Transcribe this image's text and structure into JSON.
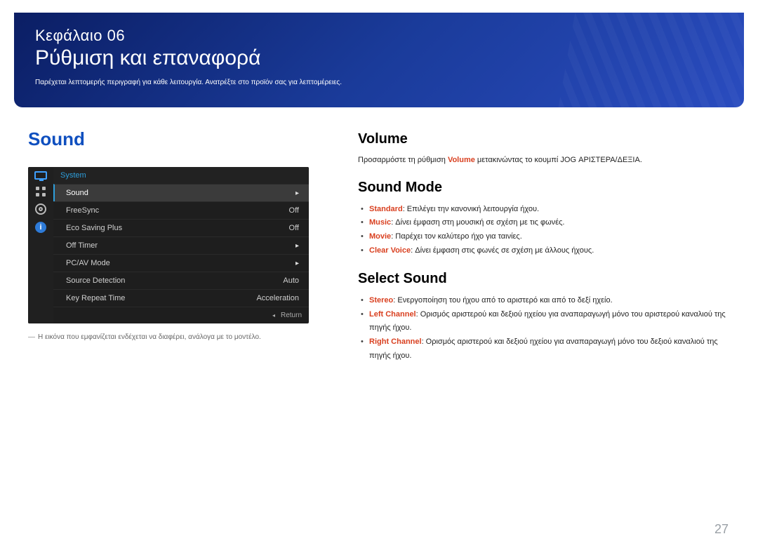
{
  "banner": {
    "chapter": "Κεφάλαιο 06",
    "title": "Ρύθμιση και επαναφορά",
    "subtitle": "Παρέχεται λεπτομερής περιγραφή για κάθε λειτουργία. Ανατρέξτε στο προϊόν σας για λεπτομέρειες."
  },
  "left": {
    "heading": "Sound",
    "footnote": "Η εικόνα που εμφανίζεται ενδέχεται να διαφέρει, ανάλογα με το μοντέλο."
  },
  "osd": {
    "header": "System",
    "rows": [
      {
        "label": "Sound",
        "value": "",
        "selected": true,
        "arrow": true
      },
      {
        "label": "FreeSync",
        "value": "Off",
        "selected": false,
        "arrow": false
      },
      {
        "label": "Eco Saving Plus",
        "value": "Off",
        "selected": false,
        "arrow": false
      },
      {
        "label": "Off Timer",
        "value": "",
        "selected": false,
        "arrow": true
      },
      {
        "label": "PC/AV Mode",
        "value": "",
        "selected": false,
        "arrow": true
      },
      {
        "label": "Source Detection",
        "value": "Auto",
        "selected": false,
        "arrow": false
      },
      {
        "label": "Key Repeat Time",
        "value": "Acceleration",
        "selected": false,
        "arrow": false
      }
    ],
    "footer": "Return"
  },
  "right": {
    "volume": {
      "heading": "Volume",
      "text_pre": "Προσαρμόστε τη ρύθμιση ",
      "text_key": "Volume",
      "text_post": " μετακινώντας το κουμπί JOG ΑΡΙΣΤΕΡΑ/ΔΕΞΙΑ."
    },
    "sound_mode": {
      "heading": "Sound Mode",
      "items": [
        {
          "key": "Standard",
          "desc": ": Επιλέγει την κανονική λειτουργία ήχου."
        },
        {
          "key": "Music",
          "desc": ": Δίνει έμφαση στη μουσική σε σχέση με τις φωνές."
        },
        {
          "key": "Movie",
          "desc": ": Παρέχει τον καλύτερο ήχο για ταινίες."
        },
        {
          "key": "Clear Voice",
          "desc": ": Δίνει έμφαση στις φωνές σε σχέση με άλλους ήχους."
        }
      ]
    },
    "select_sound": {
      "heading": "Select Sound",
      "items": [
        {
          "key": "Stereo",
          "desc": ": Ενεργοποίηση του ήχου από το αριστερό και από το δεξί ηχείο."
        },
        {
          "key": "Left Channel",
          "desc": ": Ορισμός αριστερού και δεξιού ηχείου για αναπαραγωγή μόνο του αριστερού καναλιού της πηγής ήχου."
        },
        {
          "key": "Right Channel",
          "desc": ": Ορισμός αριστερού και δεξιού ηχείου για αναπαραγωγή μόνο του δεξιού καναλιού της πηγής ήχου."
        }
      ]
    }
  },
  "page_number": "27"
}
